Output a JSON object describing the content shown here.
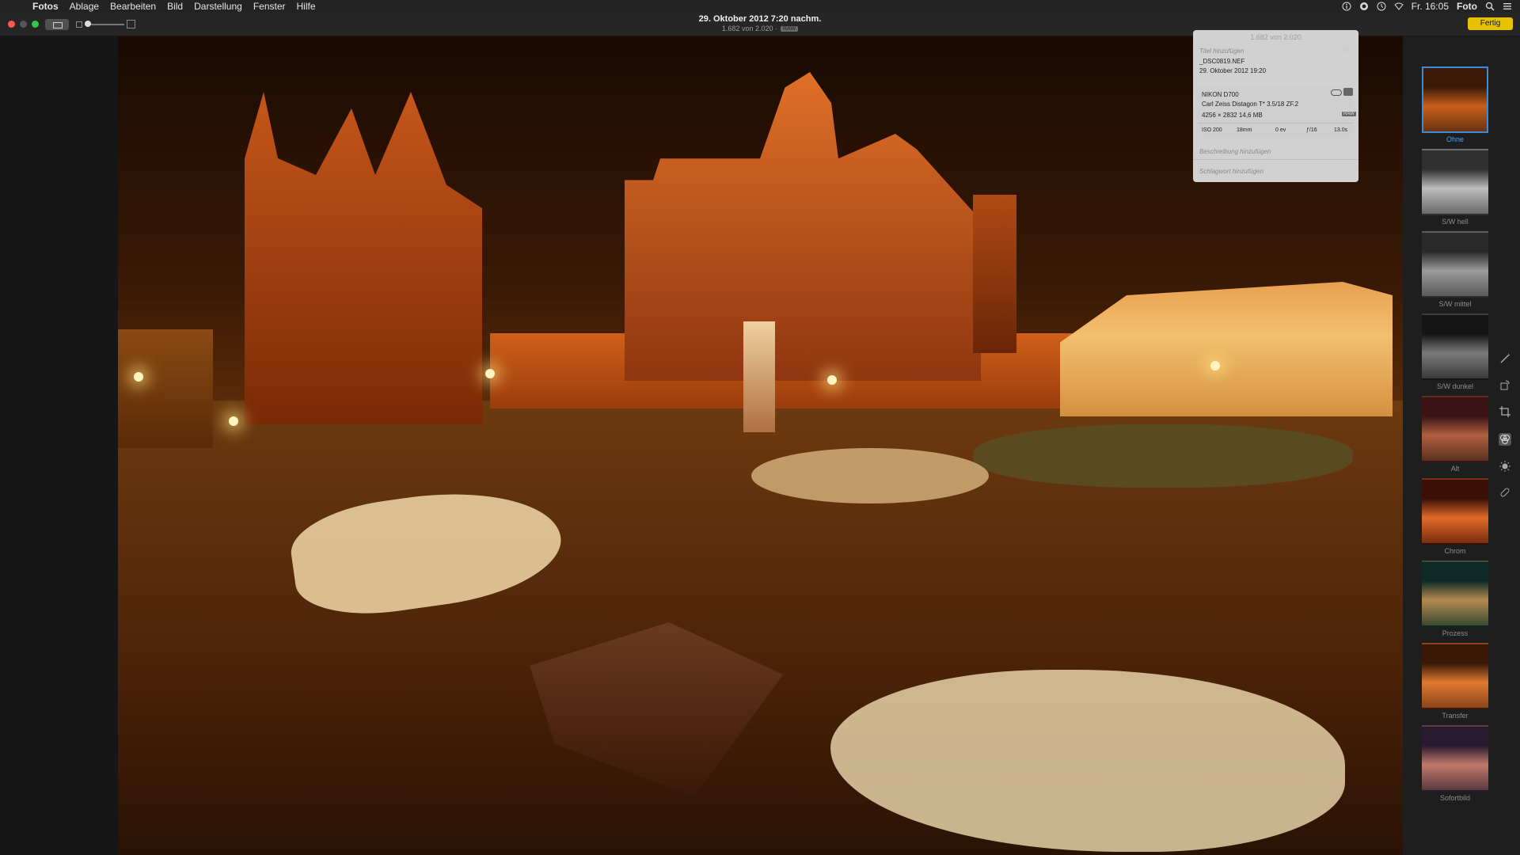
{
  "menubar": {
    "apple": "",
    "items": [
      "Fotos",
      "Ablage",
      "Bearbeiten",
      "Bild",
      "Darstellung",
      "Fenster",
      "Hilfe"
    ],
    "clock": "Fr. 16:05",
    "app_right": "Foto"
  },
  "toolbar": {
    "title": "29. Oktober 2012 7:20 nachm.",
    "subtitle": "1.682 von 2.020 ·",
    "raw": "RAW",
    "done_label": "Fertig"
  },
  "info": {
    "counter": "1.682 von 2.020",
    "add_title": "Titel hinzufügen",
    "filename": "_DSC0819.NEF",
    "datetime": "29. Oktober 2012    19:20",
    "camera": "NIKON D700",
    "lens": "Carl Zeiss Distagon T* 3.5/18 ZF.2",
    "dimensions": "4256 × 2832    14,6 MB",
    "raw": "RAW",
    "iso": "ISO 200",
    "focal": "18mm",
    "ev": "0 ev",
    "aperture": "ƒ/16",
    "shutter": "13.0s",
    "add_description": "Beschreibung hinzufügen",
    "add_keyword": "Schlagwort hinzufügen"
  },
  "filters": [
    {
      "label": "Ohne",
      "selected": true
    },
    {
      "label": "S/W hell"
    },
    {
      "label": "S/W mittel"
    },
    {
      "label": "S/W dunkel"
    },
    {
      "label": "Alt"
    },
    {
      "label": "Chrom"
    },
    {
      "label": "Prozess"
    },
    {
      "label": "Transfer"
    },
    {
      "label": "Sofortbild"
    }
  ]
}
